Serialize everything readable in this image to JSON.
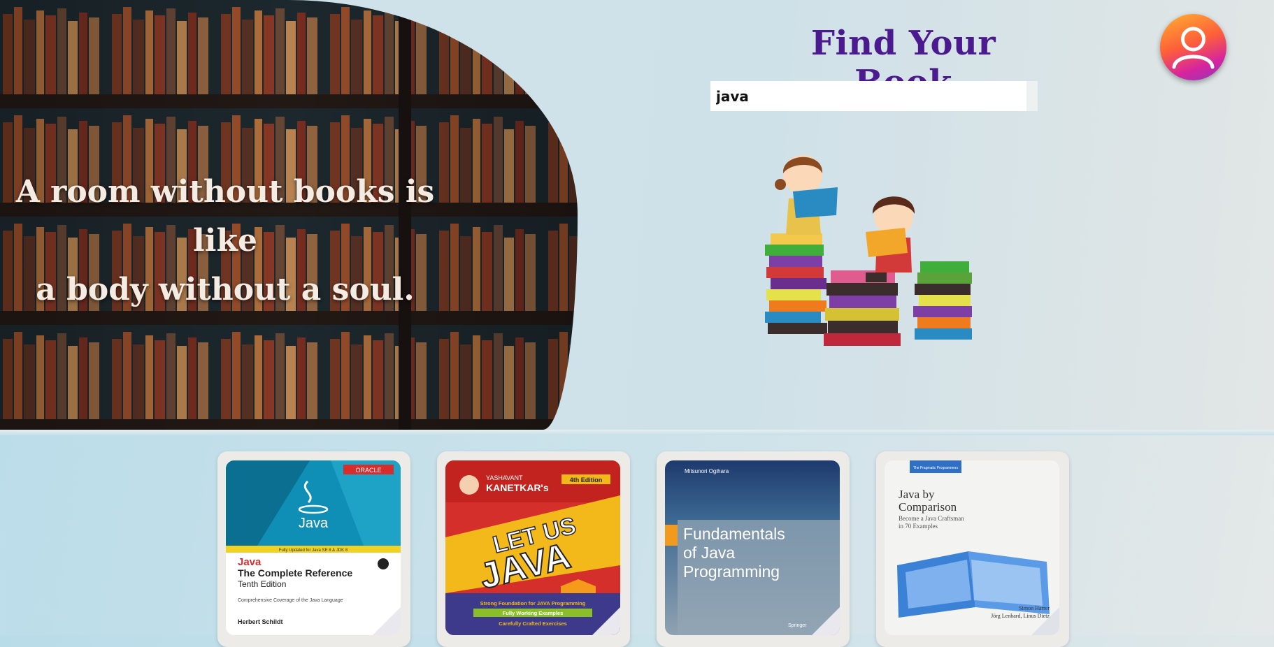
{
  "hero": {
    "quote_line1": "A room without books is like",
    "quote_line2": "a body without a soul."
  },
  "header": {
    "title": "Find Your Book"
  },
  "search": {
    "value": "java"
  },
  "profile": {
    "icon": "user-icon"
  },
  "books": [
    {
      "brand": "ORACLE",
      "logo": "Java",
      "tagline": "Fully Updated for Java SE 8 & JDK 8",
      "title": "Java",
      "subtitle": "The Complete Reference",
      "edition": "Tenth Edition",
      "desc": "Comprehensive Coverage of the Java Language",
      "author": "Herbert Schildt",
      "colors": {
        "top": "#0f8fb5",
        "bottom": "#ffffff"
      }
    },
    {
      "author_top": "YASHAVANT",
      "author": "KANETKAR's",
      "edition": "4th Edition",
      "title1": "LET US",
      "title2": "JAVA",
      "bullet1": "Strong Foundation for JAVA Programming",
      "bullet2": "Fully Working Examples",
      "bullet3": "Carefully Crafted Exercises",
      "colors": {
        "top": "#d42f2a",
        "band": "#f3b91b"
      }
    },
    {
      "author": "Mitsunori Ogihara",
      "title1": "Fundamentals",
      "title2": "of Java",
      "title3": "Programming",
      "publisher": "Springer",
      "colors": {
        "top": "#1d3a6e",
        "bottom": "#a9b8c4",
        "accent": "#f29a1e"
      }
    },
    {
      "series": "The Pragmatic Programmers",
      "title1": "Java by",
      "title2": "Comparison",
      "sub1": "Become a Java Craftsman",
      "sub2": "in 70 Examples",
      "author1": "Simon Harrer",
      "author2": "Jörg Lenhard, Linus Dietz",
      "colors": {
        "bg": "#f3f3f1",
        "accent": "#2f6fc4"
      }
    }
  ]
}
